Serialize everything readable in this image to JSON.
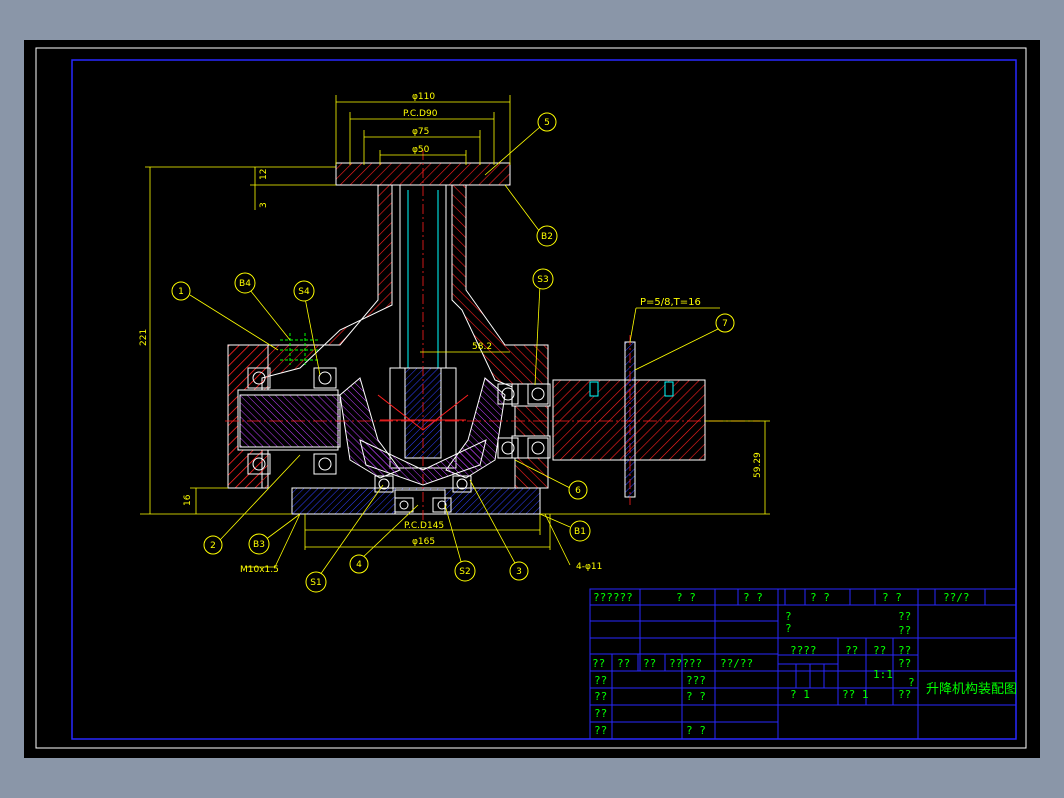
{
  "drawing": {
    "dimensions": {
      "d110": "φ110",
      "pcd90": "P.C.D90",
      "d75": "φ75",
      "d50": "φ50",
      "v12": "12",
      "v3": "3",
      "v221": "221",
      "v16": "16",
      "v58_2": "58.2",
      "v59_29": "59.29",
      "pcd145": "P.C.D145",
      "d165": "φ165",
      "m10": "M10x1.5",
      "holes": "4-φ11",
      "chain": "P=5/8,T=16"
    },
    "balloons": {
      "b1": "1",
      "b2": "2",
      "b3": "3",
      "b4": "4",
      "b5": "5",
      "b6": "6",
      "b7": "7",
      "B1": "B1",
      "B2": "B2",
      "B3": "B3",
      "B4": "B4",
      "S1": "S1",
      "S2": "S2",
      "S3": "S3",
      "S4": "S4"
    }
  },
  "title_block": {
    "header": [
      "??????",
      "?  ?",
      "?  ?",
      "?  ?",
      "?  ?",
      "??/?"
    ],
    "r_mark_top": "?",
    "r_mark_2": "?",
    "r_qq1": "??",
    "r_qq2": "??",
    "r_4q": "????",
    "r_qq3": "??",
    "r_qq4": "??",
    "r_qq5": "??",
    "row_labels": [
      "??",
      "??",
      "??",
      "?????",
      "??/??"
    ],
    "ratio": "1:1",
    "ratio_q": "??",
    "q3": "???",
    "qq_a": "? ?",
    "qq_b": "? ?",
    "left_rows": [
      "??",
      "??",
      "??",
      "??"
    ],
    "sheet_a": "?  1",
    "sheet_b": "??  1",
    "sheet_q": "??",
    "title": "升降机构装配图",
    "title_overlap": "?"
  }
}
